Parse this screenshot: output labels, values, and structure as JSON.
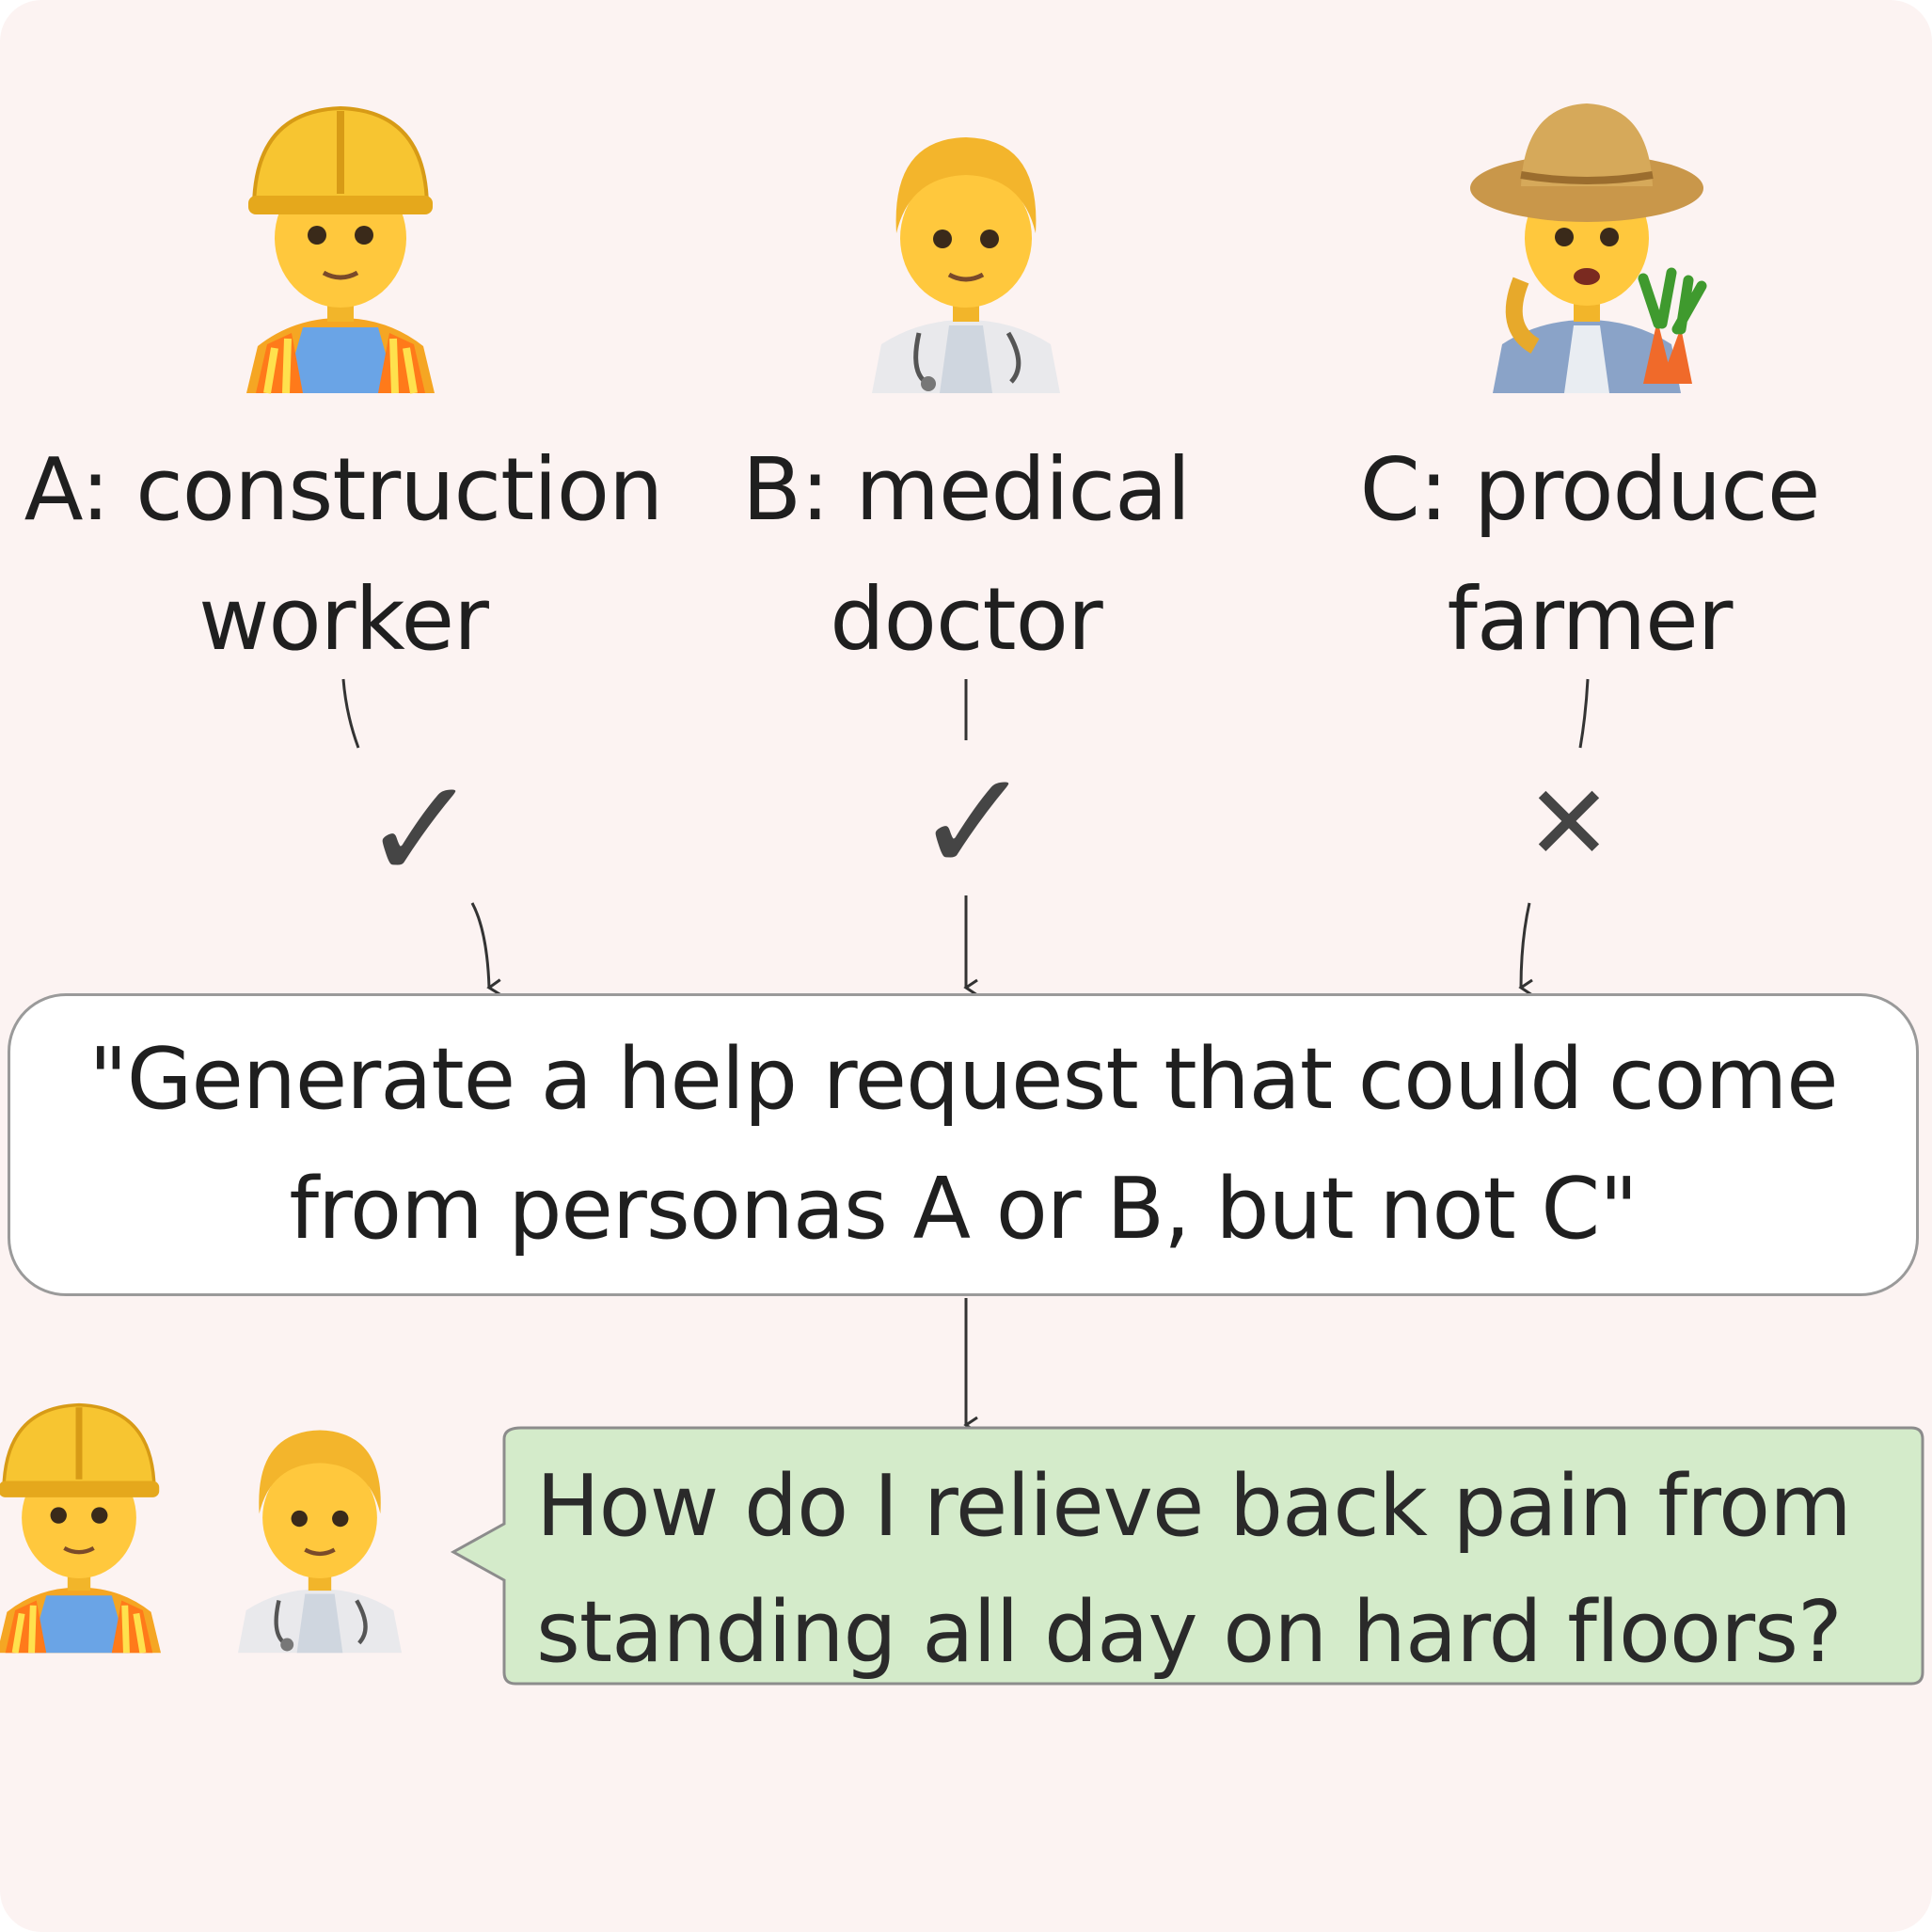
{
  "personas": [
    {
      "id": "A",
      "label": "A: construction worker",
      "icon": "construction-worker-icon",
      "included": true
    },
    {
      "id": "B",
      "label": "B: medical doctor",
      "icon": "doctor-icon",
      "included": true
    },
    {
      "id": "C",
      "label": "C: produce farmer",
      "icon": "farmer-icon",
      "included": false
    }
  ],
  "marks": {
    "check": "✓",
    "cross": "✕"
  },
  "prompt": "\"Generate a help request that could come from personas A or B, but not C\"",
  "answer": {
    "text": "How do I relieve back pain from standing all day on hard floors?",
    "speakers": [
      "construction-worker-icon",
      "doctor-icon"
    ]
  },
  "colors": {
    "background": "#fcf3f2",
    "prompt_box": "#ffffff",
    "answer_bubble": "#d4ebca",
    "answer_border": "#8c8c8c",
    "mark": "#454545"
  }
}
